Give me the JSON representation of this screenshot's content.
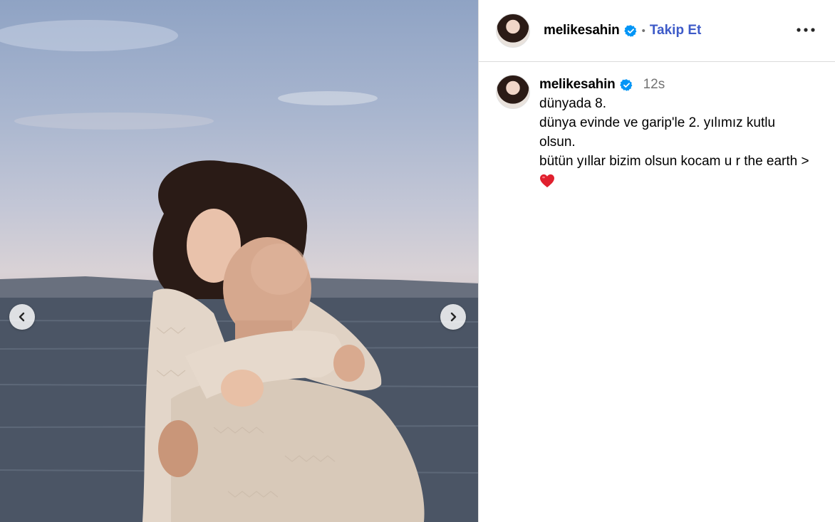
{
  "post": {
    "username": "melikesahin",
    "follow_label": "Takip Et",
    "separator": "•",
    "time": "12s",
    "caption_lines": [
      "dünyada 8.",
      "dünya evinde ve garip'le 2. yılımız kutlu olsun.",
      "bütün yıllar bizim olsun kocam u r the earth >"
    ],
    "emoji": "red-heart"
  },
  "colors": {
    "follow": "#3d5ac8",
    "verified": "#0095f6",
    "divider": "#dbdbdb",
    "muted": "#737373"
  },
  "icons": {
    "prev": "chevron-left-icon",
    "next": "chevron-right-icon",
    "more": "more-options-icon",
    "verified": "verified-badge-icon"
  }
}
